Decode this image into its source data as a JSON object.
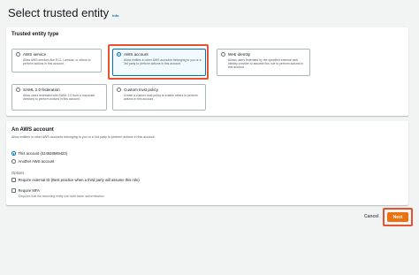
{
  "page": {
    "title": "Select trusted entity",
    "info_label": "Info"
  },
  "trusted_entity": {
    "header": "Trusted entity type",
    "options": [
      {
        "title": "AWS service",
        "desc": "Allow AWS services like EC2, Lambda, or others to perform actions in this account.",
        "selected": false
      },
      {
        "title": "AWS account",
        "desc": "Allow entities in other AWS accounts belonging to you or a 3rd party to perform actions in this account.",
        "selected": true
      },
      {
        "title": "Web identity",
        "desc": "Allows users federated by the specified external web identity provider to assume this role to perform actions in this account.",
        "selected": false
      },
      {
        "title": "SAML 2.0 federation",
        "desc": "Allow users federated with SAML 2.0 from a corporate directory to perform actions in this account.",
        "selected": false
      },
      {
        "title": "Custom trust policy",
        "desc": "Create a custom trust policy to enable others to perform actions in this account.",
        "selected": false
      }
    ]
  },
  "aws_account": {
    "header": "An AWS account",
    "sub": "Allow entities in other AWS accounts belonging to you or a 3rd party to perform actions in this account.",
    "this_account": "This account (024928569423)",
    "another_account": "Another AWS account",
    "options_label": "Options",
    "require_external_id": "Require external ID (Best practice when a third party will assume this role)",
    "require_mfa": "Require MFA",
    "require_mfa_desc": "Requires that the assuming entity use multi-factor authentication."
  },
  "footer": {
    "cancel_label": "Cancel",
    "next_label": "Next"
  },
  "colors": {
    "accent": "#0073bb",
    "primary_button": "#ec7211",
    "annotation": "#e5532f"
  }
}
